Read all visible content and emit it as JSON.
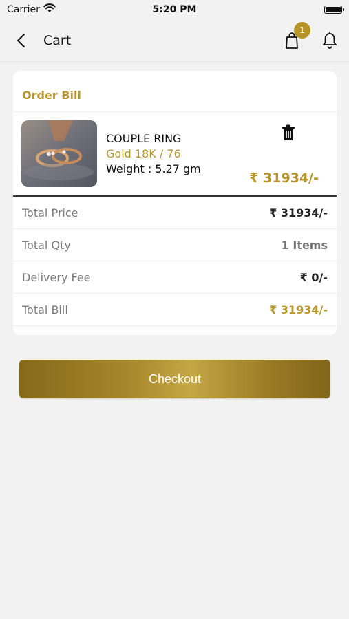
{
  "status_bar": {
    "carrier": "Carrier",
    "time": "5:20 PM",
    "wifi_icon": "wifi-icon",
    "battery_icon": "battery-icon"
  },
  "header": {
    "title": "Cart",
    "back_icon": "chevron-left-icon",
    "bag_icon": "shopping-bag-icon",
    "bag_badge": "1",
    "bell_icon": "bell-icon"
  },
  "order": {
    "title": "Order Bill",
    "item": {
      "name": "COUPLE RING",
      "variant": "Gold 18K / 76",
      "weight": "Weight : 5.27 gm",
      "price": "₹ 31934/-",
      "delete_icon": "trash-icon"
    },
    "summary": [
      {
        "label": "Total Price",
        "value": "₹ 31934/-",
        "style": "normal"
      },
      {
        "label": "Total Qty",
        "value": "1 Items",
        "style": "muted"
      },
      {
        "label": "Delivery Fee",
        "value": "₹ 0/-",
        "style": "normal"
      },
      {
        "label": "Total Bill",
        "value": "₹ 31934/-",
        "style": "gold"
      }
    ]
  },
  "checkout": {
    "label": "Checkout"
  },
  "colors": {
    "accent_gold": "#b8962e",
    "background": "#f2f2f2",
    "card": "#ffffff"
  }
}
